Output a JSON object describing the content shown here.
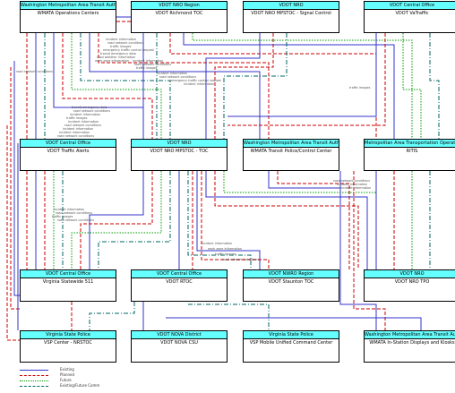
{
  "nodes": [
    {
      "id": "n1",
      "header": "Washington Metropolitan Area Transit Authority",
      "name": "WMATA Operations Centers"
    },
    {
      "id": "n2",
      "header": "VDOT NRO Region",
      "name": "VDOT Richmond TOC"
    },
    {
      "id": "n3",
      "header": "VDOT NRO",
      "name": "VDOT NRO MPSTOC - Signal Control"
    },
    {
      "id": "n4",
      "header": "VDOT Central Office",
      "name": "VDOT VaTraffic"
    },
    {
      "id": "n5",
      "header": "VDOT Central Office",
      "name": "VDOT Traffic Alerts"
    },
    {
      "id": "n6",
      "header": "VDOT NRO",
      "name": "VDOT NRO MPSTOC - TOC"
    },
    {
      "id": "n7",
      "header": "Washington Metropolitan Area Transit Authority",
      "name": "WMATA Transit Police/Control Center"
    },
    {
      "id": "n8",
      "header": "Metropolitan Area Transportation Operations Coordination",
      "name": "RITIS"
    },
    {
      "id": "n9",
      "header": "VDOT Central Office",
      "name": "Virginia Statewide 511"
    },
    {
      "id": "n10",
      "header": "VDOT Central Office",
      "name": "VDOT RTOC"
    },
    {
      "id": "n11",
      "header": "VDOT NWRO Region",
      "name": "VDOT Staunton TOC"
    },
    {
      "id": "n12",
      "header": "VDOT NRO",
      "name": "VDOT NRO TPO"
    },
    {
      "id": "n13",
      "header": "Virginia State Police",
      "name": "VSP Center - NRSTOC"
    },
    {
      "id": "n14",
      "header": "VDOT NOVA District",
      "name": "VDOT NOVA CSU"
    },
    {
      "id": "n15",
      "header": "Virginia State Police",
      "name": "VSP Mobile Unified Command Center"
    },
    {
      "id": "n16",
      "header": "Washington Metropolitan Area Transit Authority",
      "name": "WMATA In-Station Displays and Kiosks"
    }
  ],
  "flow_labels": [
    "incident information",
    "road network conditions",
    "traffic images",
    "emergency traffic control request",
    "transit emergency data",
    "road weather information",
    "work zone information",
    "incident information",
    "road network conditions",
    "traffic images",
    "incident information",
    "road network conditions",
    "emergency traffic control request",
    "incident information",
    "transit emergency data",
    "road network conditions",
    "incident information",
    "traffic images",
    "incident information",
    "road network conditions",
    "incident information",
    "incident information",
    "road network conditions",
    "traffic images",
    "road network conditions",
    "incident information",
    "incident information",
    "road network conditions",
    "incident information",
    "road network conditions",
    "traffic images",
    "road network conditions",
    "incident information",
    "work zone information",
    "traffic images",
    "road network conditions"
  ],
  "legend": [
    {
      "label": "Existing",
      "color": "#3333cc",
      "style": "solid"
    },
    {
      "label": "Planned",
      "color": "#cc0000",
      "style": "dashed"
    },
    {
      "label": "Future",
      "color": "#009900",
      "style": "dotted"
    },
    {
      "label": "Existing/Future Comm",
      "color": "#006666",
      "style": "dashdot"
    }
  ],
  "colors": {
    "header": "#66ffff",
    "existing": "#3333cc",
    "planned": "#cc0000",
    "future": "#009900",
    "comm": "#006666"
  }
}
